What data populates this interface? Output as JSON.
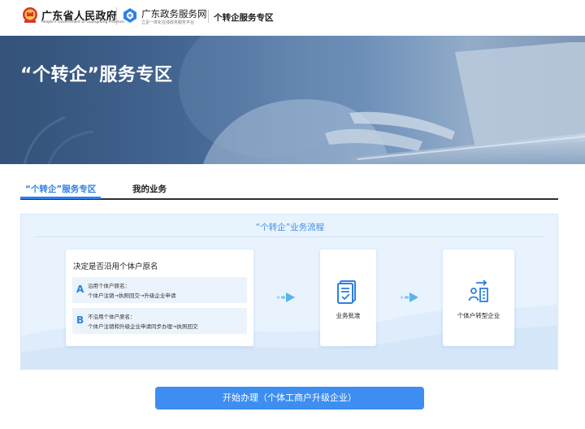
{
  "header": {
    "gov_name": "广东省人民政府",
    "gov_name_en": "People's Government of Guangdong Province",
    "service_name": "广东政务服务网",
    "service_slogan": "立足一体化在线政务服务平台",
    "zone_label": "个转企服务专区"
  },
  "banner": {
    "title": "“个转企”服务专区"
  },
  "tabs": [
    {
      "label": "“个转企”服务专区",
      "active": true
    },
    {
      "label": "我的业务",
      "active": false
    }
  ],
  "process": {
    "title": "“个转企”业务流程",
    "decide": {
      "title": "决定是否沿用个体户原名",
      "options": [
        {
          "letter": "A",
          "line1": "沿用个体户原名：",
          "line2": "个体户注销→执照回交→升级企业申请"
        },
        {
          "letter": "B",
          "line1": "不沿用个体户原名：",
          "line2": "个体户注销和升级企业申请同步办理→执照回交"
        }
      ]
    },
    "steps": [
      {
        "label": "业务批准",
        "icon": "document-check-icon"
      },
      {
        "label": "个体户转型企业",
        "icon": "transfer-enterprise-icon"
      }
    ]
  },
  "start_button": {
    "label": "开始办理（个体工商户升级企业）"
  },
  "colors": {
    "accent": "#2f80ed",
    "button": "#3d8ef0",
    "panel_bg": "#e8f3fd"
  }
}
